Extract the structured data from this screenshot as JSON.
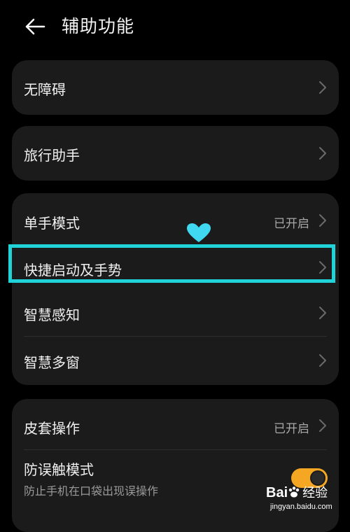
{
  "header": {
    "back_icon": "arrow-left-icon",
    "title": "辅助功能"
  },
  "groups": [
    {
      "items": [
        {
          "label": "无障碍",
          "value": "",
          "chevron_icon": "chevron-right-icon"
        }
      ]
    },
    {
      "items": [
        {
          "label": "旅行助手",
          "value": "",
          "chevron_icon": "chevron-right-icon"
        }
      ]
    },
    {
      "items": [
        {
          "label": "单手模式",
          "value": "已开启",
          "chevron_icon": "chevron-right-icon"
        },
        {
          "label": "快捷启动及手势",
          "value": "",
          "chevron_icon": "chevron-right-icon",
          "highlighted": true
        },
        {
          "label": "智慧感知",
          "value": "",
          "chevron_icon": "chevron-right-icon"
        },
        {
          "label": "智慧多窗",
          "value": "",
          "chevron_icon": "chevron-right-icon"
        }
      ]
    },
    {
      "items": [
        {
          "label": "皮套操作",
          "value": "已开启",
          "chevron_icon": "chevron-right-icon"
        },
        {
          "label": "防误触模式",
          "sublabel": "防止手机在口袋出现误操作",
          "toggle_on": true
        }
      ]
    }
  ],
  "annotation": {
    "highlight_color": "#1fd3d8",
    "heart_icon": "heart-icon"
  },
  "watermark": {
    "logo_prefix": "Bai",
    "logo_suffix": "经验",
    "url": "jingyan.baidu.com"
  },
  "colors": {
    "background": "#000000",
    "card": "#1b1b1b",
    "toggle_on": "#f5a623"
  }
}
